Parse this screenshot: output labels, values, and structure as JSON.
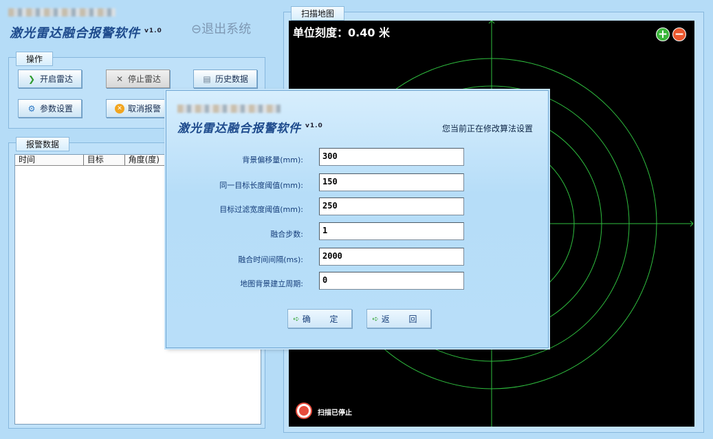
{
  "app": {
    "title": "激光雷达融合报警软件",
    "version": "v1.0",
    "exit_label": "退出系统"
  },
  "operations": {
    "group_title": "操作",
    "buttons": {
      "start": "开启雷达",
      "stop": "停止雷达",
      "history": "历史数据",
      "settings": "参数设置",
      "cancel_alarm": "取消报警"
    }
  },
  "alarm_data": {
    "group_title": "报警数据",
    "columns": [
      "时间",
      "目标",
      "角度(度)"
    ]
  },
  "scan_map": {
    "group_title": "扫描地图",
    "scale_label": "单位刻度：0.40 米",
    "zoom_in": "+",
    "zoom_out": "−",
    "status": "扫描已停止",
    "colors": {
      "background": "#000000",
      "grid": "#2fbf3f"
    }
  },
  "dialog": {
    "title": "激光雷达融合报警软件",
    "version": "v1.0",
    "note": "您当前正在修改算法设置",
    "fields": [
      {
        "label": "背景偏移量(mm):",
        "value": "300"
      },
      {
        "label": "同一目标长度阈值(mm):",
        "value": "150"
      },
      {
        "label": "目标过滤宽度阈值(mm):",
        "value": "250"
      },
      {
        "label": "融合步数:",
        "value": "1"
      },
      {
        "label": "融合时间间隔(ms):",
        "value": "2000"
      },
      {
        "label": "地图背景建立周期:",
        "value": "0"
      }
    ],
    "ok_label": "确 定",
    "back_label": "返 回"
  }
}
